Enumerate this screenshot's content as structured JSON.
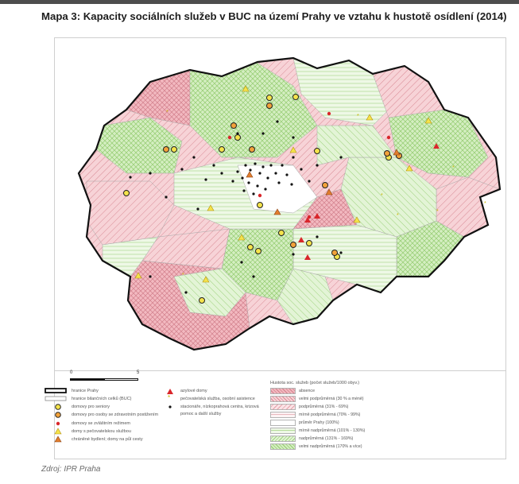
{
  "title": "Mapa 3: Kapacity sociálních služeb v BUC na území Prahy ve vztahu k hustotě osídlení (2014)",
  "source": "Zdroj: IPR Praha",
  "scale": {
    "start": "0",
    "end": "5"
  },
  "legend_left": [
    {
      "label": "hranice Prahy",
      "symbol": "thick-outline"
    },
    {
      "label": "hranice bilančních celků (BUC)",
      "symbol": "thin-outline"
    },
    {
      "label": "domovy pro seniory",
      "symbol": "yellow-circle"
    },
    {
      "label": "domovy pro osoby se zdravotním postižením",
      "symbol": "orange-circle"
    },
    {
      "label": "domovy se zvláštním režimem",
      "symbol": "red-dot"
    },
    {
      "label": "domy s pečovatelskou službou",
      "symbol": "yellow-triangle"
    },
    {
      "label": "chráněné bydlení; domy na půl cesty",
      "symbol": "orange-triangle"
    }
  ],
  "legend_mid": [
    {
      "label": "azylové domy",
      "symbol": "red-triangle"
    },
    {
      "label": "pečovatelská služba, osobní asistence",
      "symbol": "star"
    },
    {
      "label": "stacionáře, nízkoprahová centra, krizová",
      "symbol": "black-dot"
    },
    {
      "label": "pomoc a další služby",
      "symbol": "none"
    }
  ],
  "density": {
    "title": "Hustota soc. služeb (počet služeb/1000 obyv.)",
    "classes": [
      {
        "label": "absence",
        "color": "#e8a4ac"
      },
      {
        "label": "velmi podprůměrná (30 % a méně)",
        "color": "#f2c4c8"
      },
      {
        "label": "podprůměrná (31% - 69%)",
        "color": "#f6d9dc"
      },
      {
        "label": "mírně podprůměrná (70% - 99%)",
        "color": "#fbeced"
      },
      {
        "label": "průměr Prahy (100%)",
        "color": "#ffffff"
      },
      {
        "label": "mírně nadprůměrná (101% - 130%)",
        "color": "#eaf6df"
      },
      {
        "label": "nadprůměrná (131% - 169%)",
        "color": "#d6efc4"
      },
      {
        "label": "velmi nadprůměrná (170% a více)",
        "color": "#c4e8aa"
      }
    ]
  },
  "colors": {
    "prague_border": "#111111",
    "district_border": "#a7a7a7",
    "pink_fill": "#f0bcc2",
    "green_fill": "#d3eec0"
  }
}
